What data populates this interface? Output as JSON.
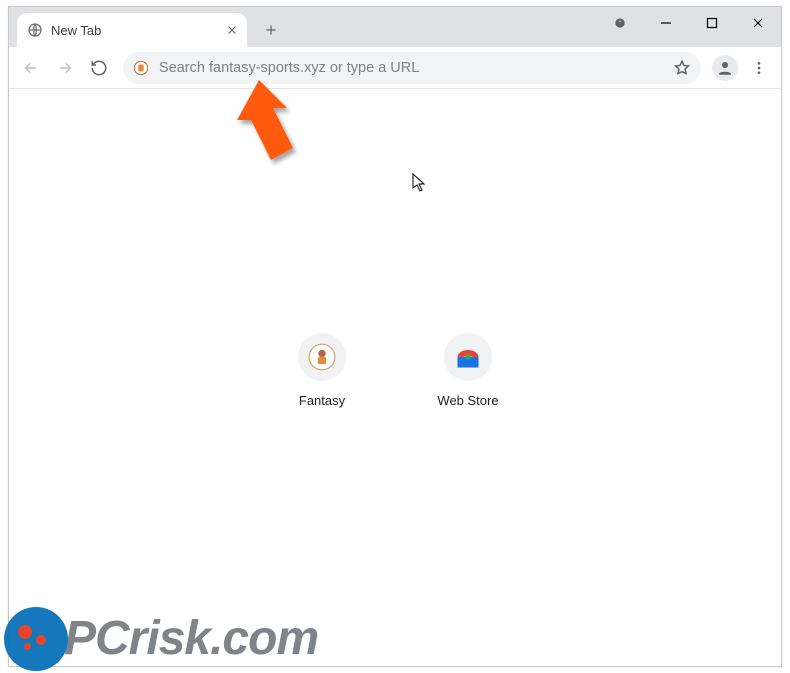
{
  "tab": {
    "title": "New Tab"
  },
  "omnibox": {
    "placeholder": "Search fantasy-sports.xyz or type a URL"
  },
  "shortcuts": [
    {
      "label": "Fantasy"
    },
    {
      "label": "Web Store"
    }
  ],
  "watermark": {
    "text": "PCrisk.com"
  },
  "colors": {
    "annotation_arrow": "#ff5a0e",
    "watermark_blue": "#0a71b9",
    "watermark_red": "#e63b1f",
    "watermark_gray": "#7a7e82"
  }
}
